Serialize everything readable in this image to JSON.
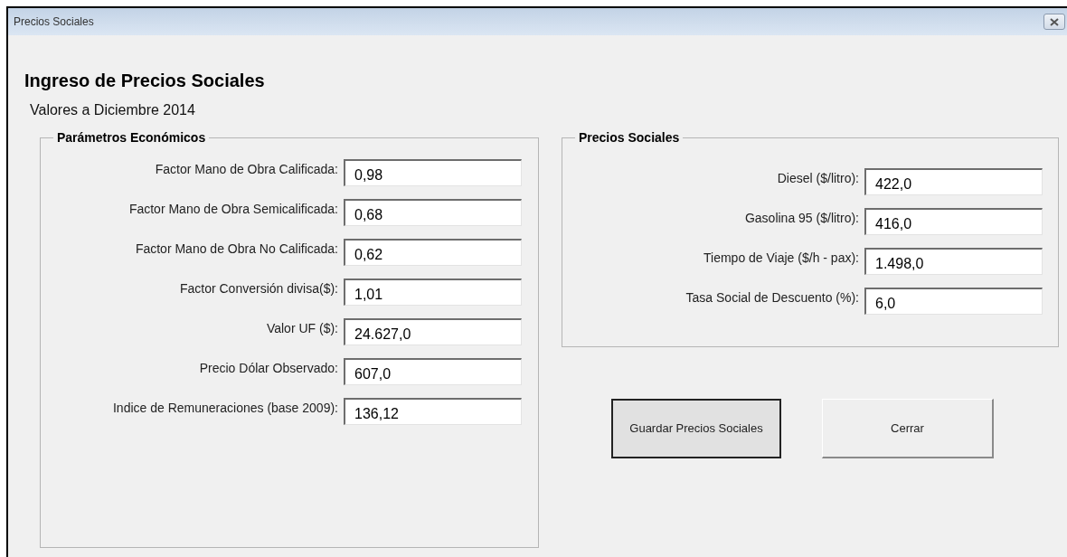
{
  "window": {
    "title": "Precios Sociales"
  },
  "heading": "Ingreso de Precios Sociales",
  "subtitle": "Valores a Diciembre 2014",
  "groups": [
    {
      "title": "Parámetros Económicos",
      "fields": [
        {
          "label": "Factor Mano de Obra Calificada:",
          "value": "0,98"
        },
        {
          "label": "Factor Mano de Obra Semicalificada:",
          "value": "0,68"
        },
        {
          "label": "Factor Mano de Obra No Calificada:",
          "value": "0,62"
        },
        {
          "label": "Factor Conversión divisa($):",
          "value": "1,01"
        },
        {
          "label": "Valor UF ($):",
          "value": "24.627,0"
        },
        {
          "label": "Precio Dólar Observado:",
          "value": "607,0"
        },
        {
          "label": "Indice de Remuneraciones (base 2009):",
          "value": "136,12"
        }
      ]
    },
    {
      "title": "Precios Sociales",
      "fields": [
        {
          "label": "Diesel ($/litro):",
          "value": "422,0"
        },
        {
          "label": "Gasolina 95 ($/litro):",
          "value": "416,0"
        },
        {
          "label": "Tiempo de Viaje ($/h - pax):",
          "value": "1.498,0"
        },
        {
          "label": "Tasa Social de Descuento (%):",
          "value": "6,0"
        }
      ]
    }
  ],
  "buttons": [
    {
      "label": "Guardar Precios Sociales",
      "default": true
    },
    {
      "label": "Cerrar",
      "default": false
    }
  ]
}
